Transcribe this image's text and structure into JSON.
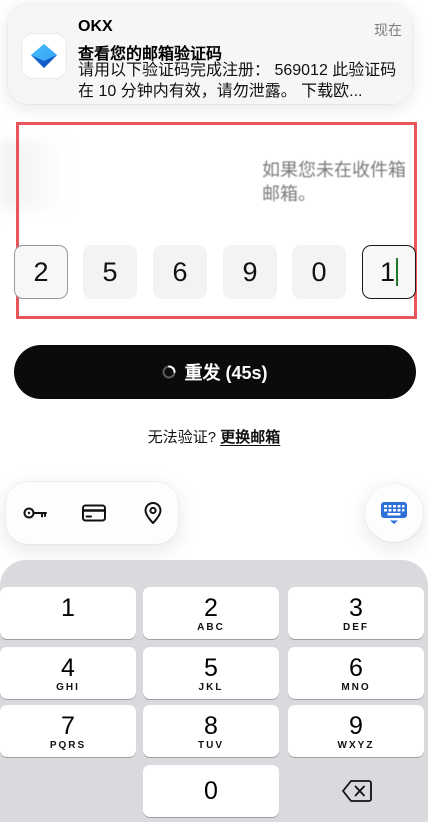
{
  "notification": {
    "app": "OKX",
    "time": "现在",
    "title": "查看您的邮箱验证码",
    "body": "请用以下验证码完成注册： 569012 此验证码在 10 分钟内有效，请勿泄露。 下载欧..."
  },
  "background_hint": {
    "line1": "如果您未在收件箱",
    "line2": "邮箱。"
  },
  "otp": {
    "digits": [
      "2",
      "5",
      "6",
      "9",
      "0",
      "1"
    ]
  },
  "resend_button": {
    "label": "重发 (45s)"
  },
  "cant_verify": {
    "text": "无法验证?",
    "link": "更换邮箱"
  },
  "autofill": {
    "icons": [
      "key-icon",
      "credit-card-icon",
      "location-pin-icon"
    ]
  },
  "keypad": {
    "keys": [
      {
        "num": "1",
        "letters": ""
      },
      {
        "num": "2",
        "letters": "ABC"
      },
      {
        "num": "3",
        "letters": "DEF"
      },
      {
        "num": "4",
        "letters": "GHI"
      },
      {
        "num": "5",
        "letters": "JKL"
      },
      {
        "num": "6",
        "letters": "MNO"
      },
      {
        "num": "7",
        "letters": "PQRS"
      },
      {
        "num": "8",
        "letters": "TUV"
      },
      {
        "num": "9",
        "letters": "WXYZ"
      },
      {
        "num": "0",
        "letters": ""
      }
    ]
  },
  "colors": {
    "highlight_border": "#e8555a",
    "button_bg": "#0b0b0b",
    "cursor": "#1f7a2e",
    "keypad_bg": "#d9dadd",
    "keyboard_toggle_icon": "#2f6fd8"
  }
}
